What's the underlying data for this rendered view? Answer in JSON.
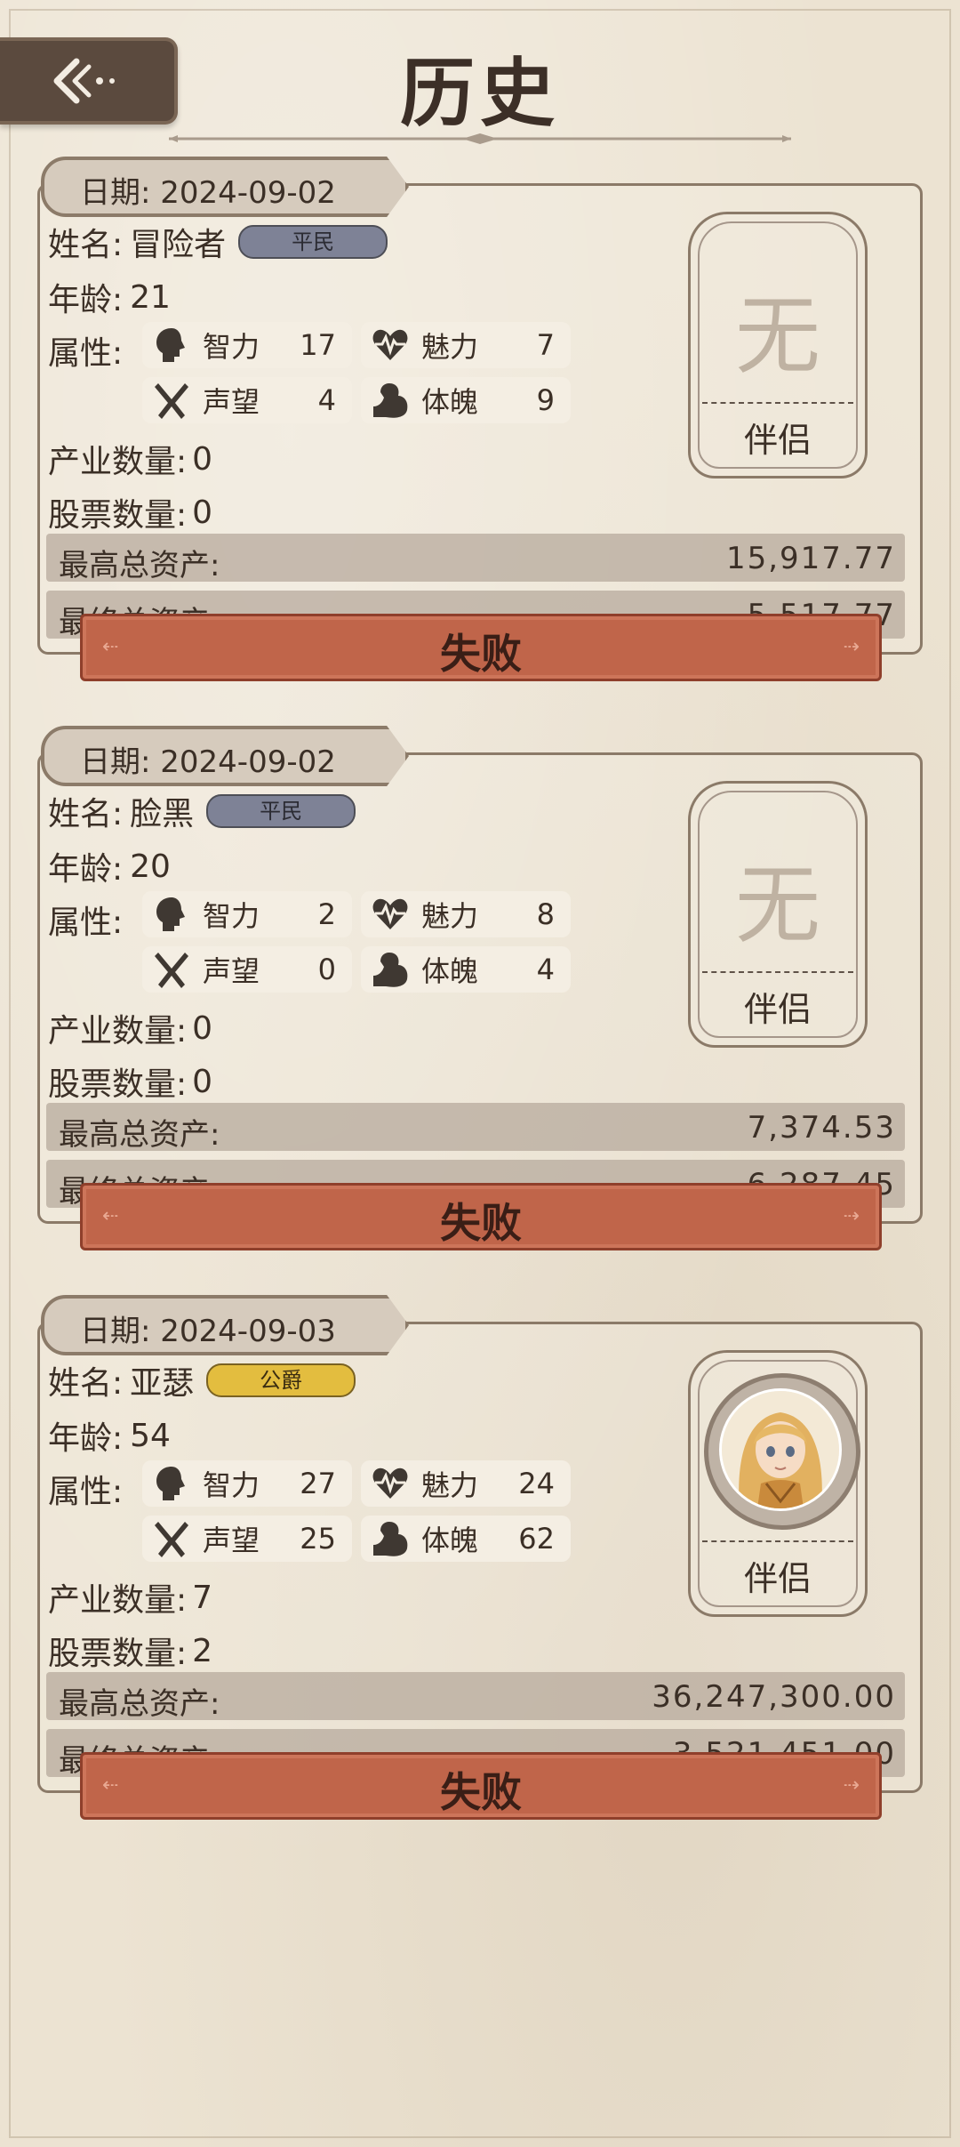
{
  "header": {
    "title": "历史",
    "back_icon": "back-arrow-icon"
  },
  "labels": {
    "date": "日期:",
    "name": "姓名:",
    "age": "年龄:",
    "attributes": "属性:",
    "property_count": "产业数量:",
    "stock_count": "股票数量:",
    "max_assets": "最高总资产:",
    "final_assets": "最终总资产:",
    "companion": "伴侣",
    "no_companion": "无",
    "attr_int": "智力",
    "attr_cha": "魅力",
    "attr_rep": "声望",
    "attr_phy": "体魄"
  },
  "records": [
    {
      "date": "2024-09-02",
      "name": "冒险者",
      "rank": "平民",
      "age": "21",
      "int": "17",
      "cha": "7",
      "rep": "4",
      "phy": "9",
      "property_count": "0",
      "stock_count": "0",
      "max_assets": "15,917.77",
      "final_assets": "5,517.77",
      "result": "失败"
    },
    {
      "date": "2024-09-02",
      "name": "脸黑",
      "rank": "平民",
      "age": "20",
      "int": "2",
      "cha": "8",
      "rep": "0",
      "phy": "4",
      "property_count": "0",
      "stock_count": "0",
      "max_assets": "7,374.53",
      "final_assets": "6,287.45",
      "result": "失败"
    },
    {
      "date": "2024-09-03",
      "name": "亚瑟",
      "rank": "公爵",
      "age": "54",
      "int": "27",
      "cha": "24",
      "rep": "25",
      "phy": "62",
      "property_count": "7",
      "stock_count": "2",
      "max_assets": "36,247,300.00",
      "final_assets": "3,521,451.00",
      "result": "失败"
    }
  ],
  "colors": {
    "background": "#ece3d2",
    "header_button": "#5b4a3e",
    "fail_banner": "#c0654a",
    "rank_civilian": "#7e8296",
    "rank_duke": "#e3bd3f"
  }
}
